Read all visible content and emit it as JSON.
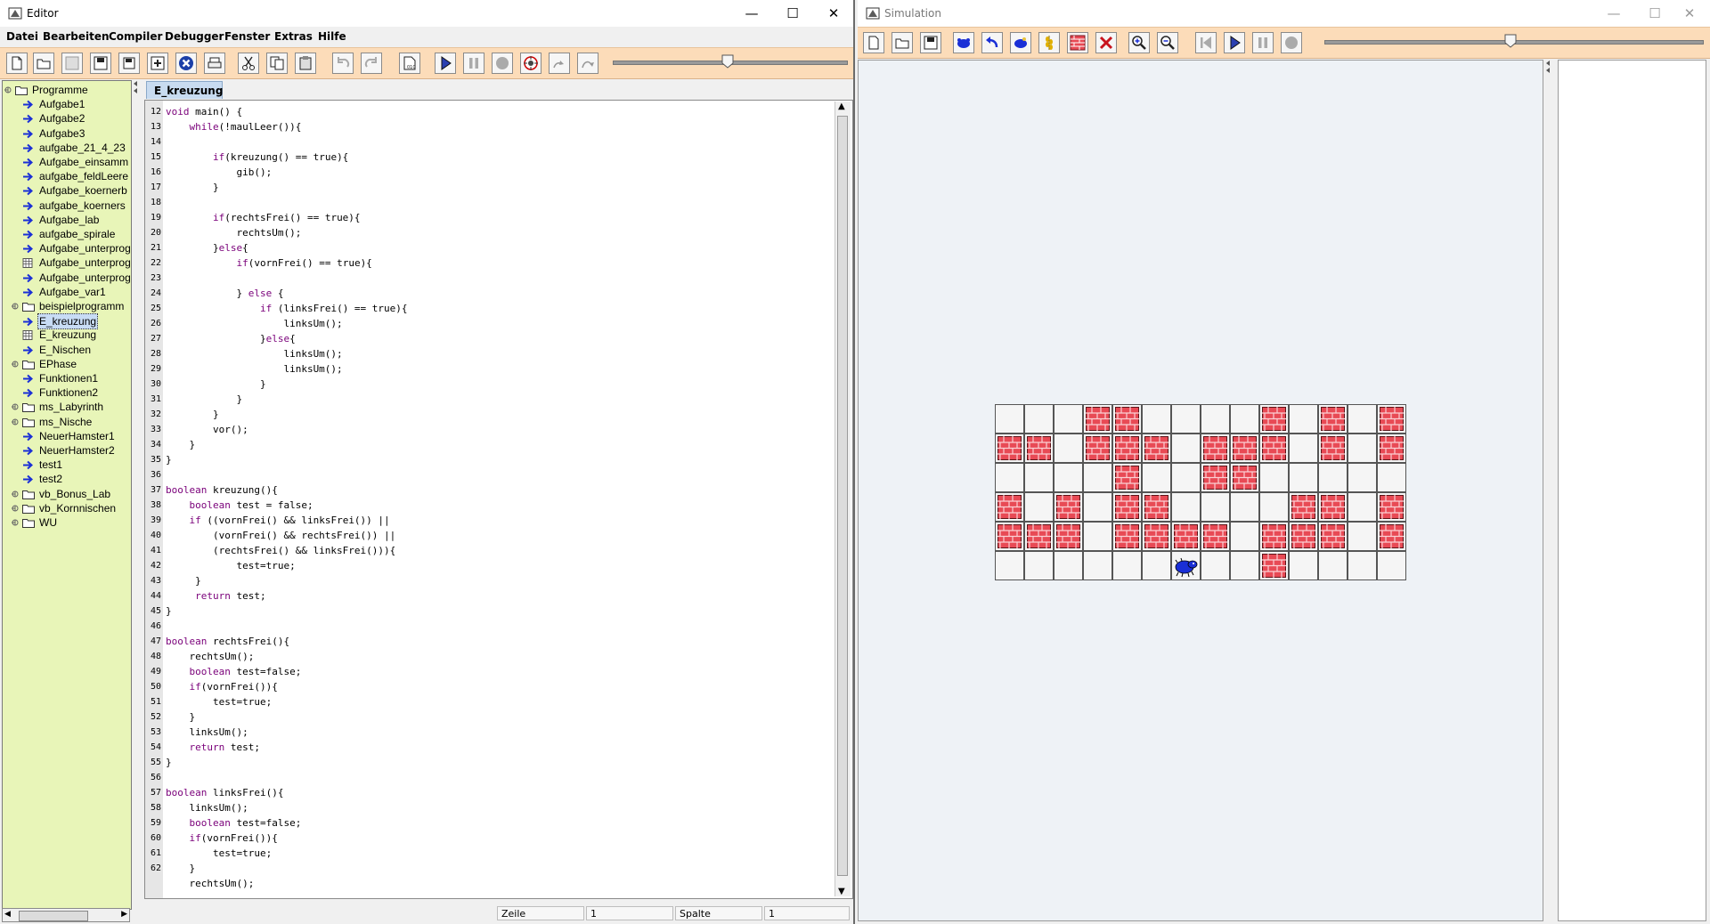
{
  "editor": {
    "window_title": "Editor",
    "menus": [
      "Datei",
      "Bearbeiten",
      "Compiler",
      "Debugger",
      "Fenster",
      "Extras",
      "Hilfe"
    ],
    "tab_label": "E_kreuzung",
    "tree": [
      {
        "label": "Programme",
        "type": "folder",
        "level": 0,
        "expanded": true
      },
      {
        "label": "Aufgabe1",
        "type": "program",
        "level": 1
      },
      {
        "label": "Aufgabe2",
        "type": "program",
        "level": 1
      },
      {
        "label": "Aufgabe3",
        "type": "program",
        "level": 1
      },
      {
        "label": "aufgabe_21_4_23",
        "type": "program",
        "level": 1
      },
      {
        "label": "Aufgabe_einsamm",
        "type": "program",
        "level": 1
      },
      {
        "label": "aufgabe_feldLeere",
        "type": "program",
        "level": 1
      },
      {
        "label": "Aufgabe_koernerb",
        "type": "program",
        "level": 1
      },
      {
        "label": "aufgabe_koerners",
        "type": "program",
        "level": 1
      },
      {
        "label": "Aufgabe_lab",
        "type": "program",
        "level": 1
      },
      {
        "label": "aufgabe_spirale",
        "type": "program",
        "level": 1
      },
      {
        "label": "Aufgabe_unterprog",
        "type": "program",
        "level": 1
      },
      {
        "label": "Aufgabe_unterprog",
        "type": "territory",
        "level": 1
      },
      {
        "label": "Aufgabe_unterprog",
        "type": "program",
        "level": 1
      },
      {
        "label": "Aufgabe_var1",
        "type": "program",
        "level": 1
      },
      {
        "label": "beispielprogramm",
        "type": "folder",
        "level": 1,
        "expanded": true
      },
      {
        "label": "E_kreuzung",
        "type": "program",
        "level": 1,
        "selected": true
      },
      {
        "label": "E_kreuzung",
        "type": "territory",
        "level": 1
      },
      {
        "label": "E_Nischen",
        "type": "program",
        "level": 1
      },
      {
        "label": "EPhase",
        "type": "folder",
        "level": 1,
        "expanded": true
      },
      {
        "label": "Funktionen1",
        "type": "program",
        "level": 1
      },
      {
        "label": "Funktionen2",
        "type": "program",
        "level": 1
      },
      {
        "label": "ms_Labyrinth",
        "type": "folder",
        "level": 1
      },
      {
        "label": "ms_Nische",
        "type": "folder",
        "level": 1,
        "expanded": true
      },
      {
        "label": "NeuerHamster1",
        "type": "program",
        "level": 1
      },
      {
        "label": "NeuerHamster2",
        "type": "program",
        "level": 1
      },
      {
        "label": "test1",
        "type": "program",
        "level": 1
      },
      {
        "label": "test2",
        "type": "program",
        "level": 1
      },
      {
        "label": "vb_Bonus_Lab",
        "type": "folder",
        "level": 1
      },
      {
        "label": "vb_Kornnischen",
        "type": "folder",
        "level": 1
      },
      {
        "label": "WU",
        "type": "folder",
        "level": 1
      }
    ],
    "code_lines": [
      {
        "n": "12",
        "text": "void main() {"
      },
      {
        "n": "13",
        "text": "    while(!maulLeer()){"
      },
      {
        "n": "14",
        "text": ""
      },
      {
        "n": "15",
        "text": "        if(kreuzung() == true){"
      },
      {
        "n": "16",
        "text": "            gib();"
      },
      {
        "n": "17",
        "text": "        }"
      },
      {
        "n": "18",
        "text": ""
      },
      {
        "n": "19",
        "text": "        if(rechtsFrei() == true){"
      },
      {
        "n": "20",
        "text": "            rechtsUm();"
      },
      {
        "n": "21",
        "text": "        }else{"
      },
      {
        "n": "22",
        "text": "            if(vornFrei() == true){"
      },
      {
        "n": "23",
        "text": ""
      },
      {
        "n": "24",
        "text": "            } else {"
      },
      {
        "n": "25",
        "text": "                if (linksFrei() == true){"
      },
      {
        "n": "26",
        "text": "                    linksUm();"
      },
      {
        "n": "27",
        "text": "                }else{"
      },
      {
        "n": "28",
        "text": "                    linksUm();"
      },
      {
        "n": "29",
        "text": "                    linksUm();"
      },
      {
        "n": "30",
        "text": "                }"
      },
      {
        "n": "31",
        "text": "            }"
      },
      {
        "n": "32",
        "text": "        }"
      },
      {
        "n": "33",
        "text": "        vor();"
      },
      {
        "n": "34",
        "text": "    }"
      },
      {
        "n": "35",
        "text": "}"
      },
      {
        "n": "36",
        "text": ""
      },
      {
        "n": "37",
        "text": "boolean kreuzung(){"
      },
      {
        "n": "38",
        "text": "    boolean test = false;"
      },
      {
        "n": "39",
        "text": "    if ((vornFrei() && linksFrei()) ||"
      },
      {
        "n": "40",
        "text": "        (vornFrei() && rechtsFrei()) ||"
      },
      {
        "n": "41",
        "text": "        (rechtsFrei() && linksFrei())){"
      },
      {
        "n": "42",
        "text": "            test=true;"
      },
      {
        "n": "43",
        "text": "     }"
      },
      {
        "n": "44",
        "text": "     return test;"
      },
      {
        "n": "45",
        "text": "}"
      },
      {
        "n": "46",
        "text": ""
      },
      {
        "n": "47",
        "text": "boolean rechtsFrei(){"
      },
      {
        "n": "48",
        "text": "    rechtsUm();"
      },
      {
        "n": "49",
        "text": "    boolean test=false;"
      },
      {
        "n": "50",
        "text": "    if(vornFrei()){"
      },
      {
        "n": "51",
        "text": "        test=true;"
      },
      {
        "n": "52",
        "text": "    }"
      },
      {
        "n": "53",
        "text": "    linksUm();"
      },
      {
        "n": "54",
        "text": "    return test;"
      },
      {
        "n": "55",
        "text": "}"
      },
      {
        "n": "56",
        "text": ""
      },
      {
        "n": "57",
        "text": "boolean linksFrei(){"
      },
      {
        "n": "58",
        "text": "    linksUm();"
      },
      {
        "n": "59",
        "text": "    boolean test=false;"
      },
      {
        "n": "60",
        "text": "    if(vornFrei()){"
      },
      {
        "n": "61",
        "text": "        test=true;"
      },
      {
        "n": "62",
        "text": "    }"
      },
      {
        "n": "",
        "text": "    rechtsUm();"
      }
    ],
    "status": {
      "line_label": "Zeile",
      "line_value": "1",
      "column_label": "Spalte",
      "column_value": "1"
    }
  },
  "simulation": {
    "window_title": "Simulation",
    "territory": {
      "cols": 14,
      "rows": 6,
      "walls": [
        [
          0,
          3
        ],
        [
          0,
          4
        ],
        [
          0,
          9
        ],
        [
          0,
          11
        ],
        [
          0,
          13
        ],
        [
          1,
          0
        ],
        [
          1,
          1
        ],
        [
          1,
          3
        ],
        [
          1,
          4
        ],
        [
          1,
          5
        ],
        [
          1,
          7
        ],
        [
          1,
          8
        ],
        [
          1,
          9
        ],
        [
          1,
          11
        ],
        [
          1,
          13
        ],
        [
          2,
          4
        ],
        [
          2,
          7
        ],
        [
          2,
          8
        ],
        [
          3,
          0
        ],
        [
          3,
          2
        ],
        [
          3,
          4
        ],
        [
          3,
          5
        ],
        [
          3,
          10
        ],
        [
          3,
          11
        ],
        [
          3,
          13
        ],
        [
          4,
          0
        ],
        [
          4,
          1
        ],
        [
          4,
          2
        ],
        [
          4,
          4
        ],
        [
          4,
          5
        ],
        [
          4,
          6
        ],
        [
          4,
          7
        ],
        [
          4,
          9
        ],
        [
          4,
          10
        ],
        [
          4,
          11
        ],
        [
          4,
          13
        ],
        [
          5,
          9
        ]
      ],
      "hamster": {
        "row": 5,
        "col": 6,
        "direction": "east"
      }
    }
  },
  "colors": {
    "toolbar_bg": "#fcdcb9",
    "tree_bg": "#e8f5b8",
    "keyword": "#7a007a",
    "wall_red": "#e84a55",
    "hamster_blue": "#1a2fd6"
  }
}
